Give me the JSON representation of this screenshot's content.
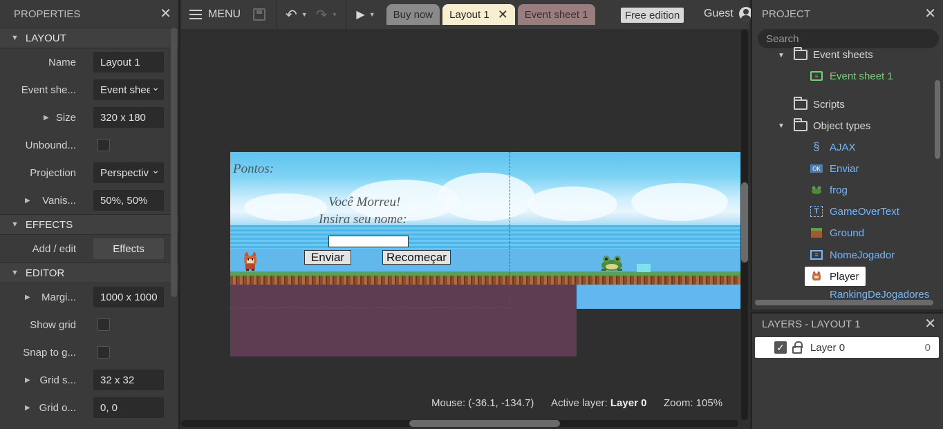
{
  "properties_panel": {
    "title": "PROPERTIES",
    "sections": {
      "layout": "LAYOUT",
      "effects": "EFFECTS",
      "editor": "EDITOR"
    },
    "rows": {
      "name_label": "Name",
      "name_value": "Layout 1",
      "eventsheet_label": "Event she...",
      "eventsheet_value": "Event shee",
      "size_label": "Size",
      "size_value": "320 x 180",
      "unbounded_label": "Unbound...",
      "projection_label": "Projection",
      "projection_value": "Perspectiv",
      "vanishing_label": "Vanis...",
      "vanishing_value": "50%, 50%",
      "addedit_label": "Add / edit",
      "effects_button": "Effects",
      "margins_label": "Margi...",
      "margins_value": "1000 x 1000",
      "showgrid_label": "Show grid",
      "snap_label": "Snap to g...",
      "gridsize_label": "Grid s...",
      "gridsize_value": "32 x 32",
      "gridoffset_label": "Grid o...",
      "gridoffset_value": "0, 0"
    }
  },
  "toolbar": {
    "menu_label": "MENU",
    "tabs": [
      {
        "label": "Buy now"
      },
      {
        "label": "Layout 1"
      },
      {
        "label": "Event sheet 1"
      }
    ],
    "free_edition": "Free edition",
    "guest": "Guest"
  },
  "canvas": {
    "game_texts": {
      "pontos": "Pontos:",
      "voce_morreu": "Você Morreu!",
      "insira_nome": "Insira seu nome:",
      "enviar": "Enviar",
      "recomecar": "Recomeçar"
    },
    "status": {
      "mouse": "Mouse: (-36.1, -134.7)",
      "active_layer_label": "Active layer:",
      "active_layer_value": "Layer 0",
      "zoom": "Zoom: 105%"
    }
  },
  "project_panel": {
    "title": "PROJECT",
    "search_placeholder": "Search",
    "tree": {
      "event_sheets": "Event sheets",
      "event_sheet_1": "Event sheet 1",
      "scripts": "Scripts",
      "object_types": "Object types",
      "objects": [
        "AJAX",
        "Enviar",
        "frog",
        "GameOverText",
        "Ground",
        "NomeJogador",
        "Player",
        "RankingDeJogadores"
      ]
    }
  },
  "layers_panel": {
    "title": "LAYERS - LAYOUT 1",
    "layers": [
      {
        "name": "Layer 0",
        "count": "0"
      }
    ]
  },
  "colors": {
    "object_label": "#73b7ff",
    "event_sheet_label": "#6fd36f",
    "active_tab": "#f7efcf"
  }
}
